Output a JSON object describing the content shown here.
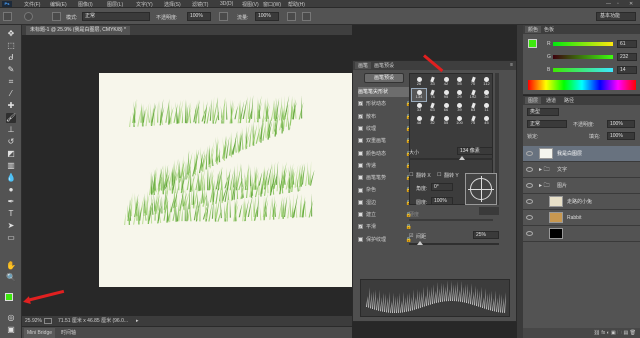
{
  "menubar": {
    "logo": "Ps",
    "items": [
      "文件(F)",
      "编辑(E)",
      "图像(I)",
      "图层(L)",
      "文字(Y)",
      "选择(S)",
      "滤镜(T)",
      "3D(D)",
      "视图(V)",
      "窗口(W)",
      "帮助(H)"
    ]
  },
  "options": {
    "mode_label": "模式:",
    "mode_value": "正常",
    "opacity_label": "不透明度:",
    "opacity_value": "100%",
    "flow_label": "流量:",
    "flow_value": "100%",
    "workspace": "基本功能"
  },
  "document": {
    "tab_title": "未标题-1 @ 25.9% (我是白图层, CMYK/8) *",
    "zoom": "25.92%",
    "doc_info": "71.51 厘米 x 46.85 厘米 (96.0..."
  },
  "bottom_tabs": [
    "Mini Bridge",
    "时间轴"
  ],
  "brush_panel": {
    "tabs": [
      "画笔",
      "画笔预设"
    ],
    "presets_button": "画笔预设",
    "items": [
      {
        "label": "画笔笔尖形状",
        "checked": false,
        "lock": false,
        "active": true
      },
      {
        "label": "形状动态",
        "checked": true,
        "lock": true
      },
      {
        "label": "散布",
        "checked": true,
        "lock": true
      },
      {
        "label": "纹理",
        "checked": false,
        "lock": true
      },
      {
        "label": "双重画笔",
        "checked": false,
        "lock": true
      },
      {
        "label": "颜色动态",
        "checked": false,
        "lock": true
      },
      {
        "label": "传递",
        "checked": false,
        "lock": true
      },
      {
        "label": "画笔笔势",
        "checked": false,
        "lock": true
      },
      {
        "label": "杂色",
        "checked": false,
        "lock": true
      },
      {
        "label": "湿边",
        "checked": false,
        "lock": true
      },
      {
        "label": "建立",
        "checked": false,
        "lock": true
      },
      {
        "label": "平滑",
        "checked": true,
        "lock": true
      },
      {
        "label": "保护纹理",
        "checked": false,
        "lock": true
      }
    ],
    "tip_sizes": [
      "26",
      "33",
      "42",
      "55",
      "70",
      "112",
      "134",
      "74",
      "95",
      "29",
      "192",
      "36",
      "33",
      "63",
      "66",
      "39",
      "63",
      "11",
      "48",
      "32",
      "55",
      "100",
      "75",
      "45"
    ],
    "selected_tip_size": "134",
    "size_label": "大小",
    "size_value": "134 像素",
    "flip_x_label": "翻转 X",
    "flip_y_label": "翻转 Y",
    "angle_label": "角度:",
    "angle_value": "0°",
    "roundness_label": "圆度:",
    "roundness_value": "100%",
    "hardness_label": "硬度",
    "spacing_label": "间距",
    "spacing_value": "25%",
    "spacing_checked": true
  },
  "color_panel": {
    "tabs": [
      "颜色",
      "色板"
    ],
    "r_label": "R",
    "r_value": "61",
    "g_label": "G",
    "g_value": "232",
    "b_label": "B",
    "b_value": "14",
    "foreground_color": "#3de80e",
    "background_color": "#1a1a1a"
  },
  "layers_panel": {
    "tabs": [
      "图层",
      "通道",
      "路径"
    ],
    "filter_label": "类型",
    "blend_mode": "正常",
    "opacity_label": "不透明度:",
    "opacity_value": "100%",
    "lock_label": "锁定:",
    "fill_label": "填充:",
    "fill_value": "100%",
    "layers": [
      {
        "name": "我是白图层",
        "type": "layer",
        "active": true,
        "thumb": "#f5f5ee"
      },
      {
        "name": "文字",
        "type": "group",
        "active": false
      },
      {
        "name": "图片",
        "type": "group",
        "active": false
      },
      {
        "name": "走路的小兔",
        "type": "layer",
        "active": false,
        "thumb": "#e8e0c8"
      },
      {
        "name": "Rabbit",
        "type": "layer",
        "active": false,
        "thumb": "#c89850"
      },
      {
        "name": "",
        "type": "layer",
        "active": false,
        "thumb": "#000000"
      }
    ]
  },
  "colors": {
    "grass_light": "#b7dc8f",
    "grass_mid": "#86c45a",
    "grass_dark": "#5aa134",
    "arrow": "#e02020",
    "canvas": "#f7f6eb"
  }
}
